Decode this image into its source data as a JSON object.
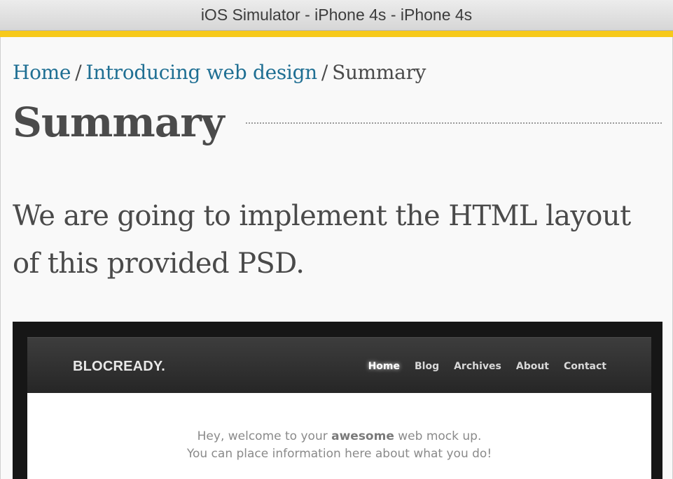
{
  "window": {
    "title": "iOS Simulator - iPhone 4s - iPhone 4s"
  },
  "colors": {
    "accent": "#f6c91b",
    "link": "#1f6f93",
    "text": "#4a4a4a"
  },
  "breadcrumb": {
    "items": [
      {
        "label": "Home",
        "link": true
      },
      {
        "label": "Introducing web design",
        "link": true
      },
      {
        "label": "Summary",
        "link": false
      }
    ],
    "separator": "/"
  },
  "page": {
    "title": "Summary",
    "intro": "We are going to implement the HTML layout of this provided PSD."
  },
  "mockup": {
    "logo": "BLOCREADY.",
    "nav": [
      "Home",
      "Blog",
      "Archives",
      "About",
      "Contact"
    ],
    "active_nav": "Home",
    "welcome_line1_prefix": "Hey, welcome to your ",
    "welcome_line1_bold": "awesome",
    "welcome_line1_suffix": " web mock up.",
    "welcome_line2": "You can place information here about what you do!"
  }
}
